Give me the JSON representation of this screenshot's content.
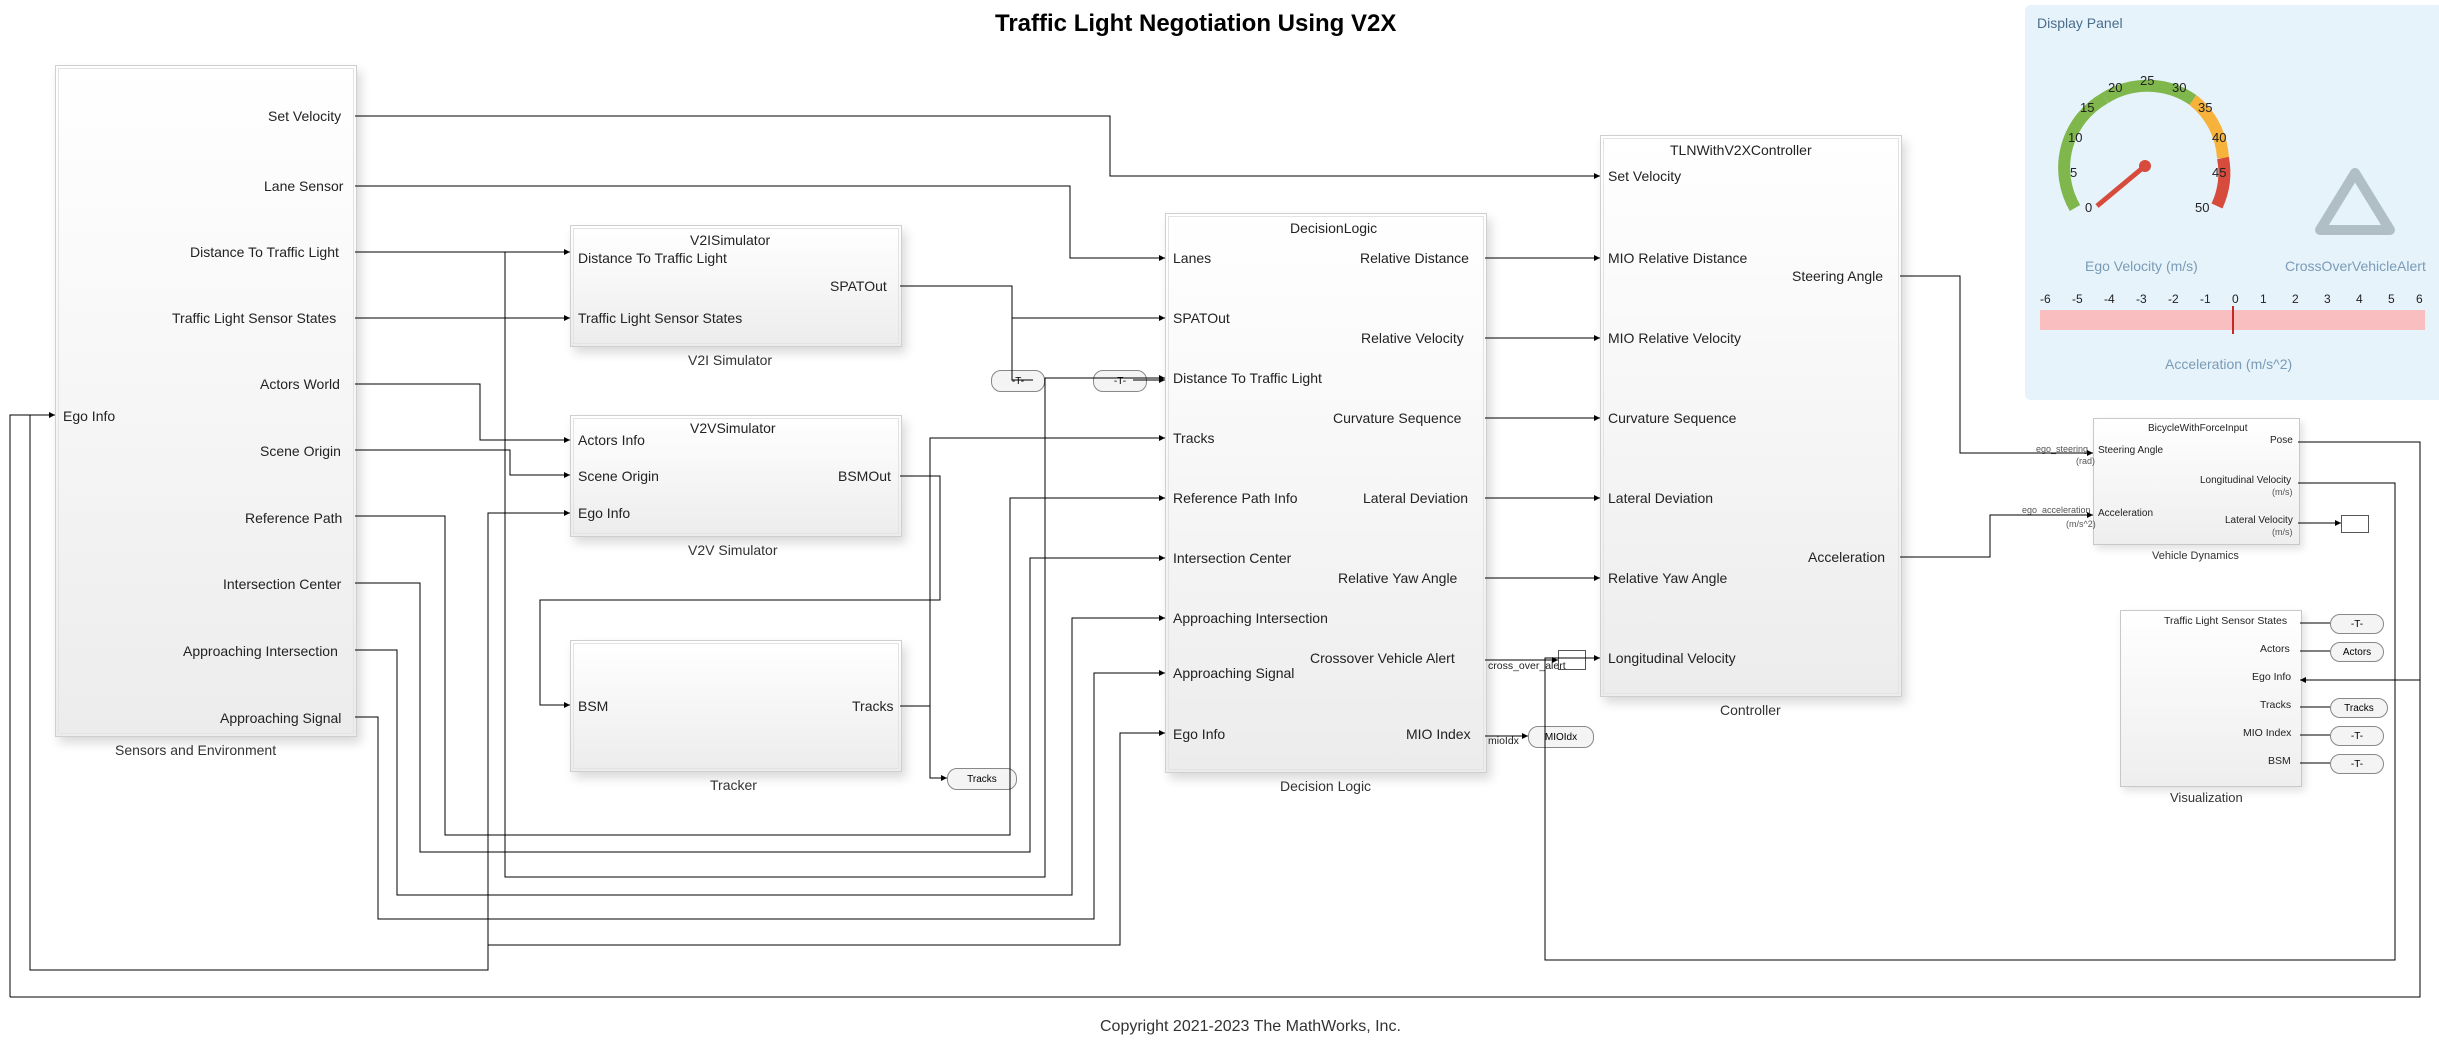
{
  "title": "Traffic Light Negotiation Using V2X",
  "copyright": "Copyright 2021-2023 The MathWorks, Inc.",
  "blocks": {
    "sensors": {
      "name": "Sensors and Environment",
      "inputs": [
        "Ego Info"
      ],
      "outputs": [
        "Set Velocity",
        "Lane Sensor",
        "Distance To Traffic Light",
        "Traffic Light Sensor States",
        "Actors World",
        "Scene Origin",
        "Reference Path",
        "Intersection Center",
        "Approaching Intersection",
        "Approaching Signal"
      ]
    },
    "v2i": {
      "name": "V2I Simulator",
      "header": "V2ISimulator",
      "inputs": [
        "Distance To Traffic Light",
        "Traffic Light Sensor States"
      ],
      "outputs": [
        "SPATOut"
      ]
    },
    "v2v": {
      "name": "V2V Simulator",
      "header": "V2VSimulator",
      "inputs": [
        "Actors Info",
        "Scene Origin",
        "Ego Info"
      ],
      "outputs": [
        "BSMOut"
      ]
    },
    "tracker": {
      "name": "Tracker",
      "inputs": [
        "BSM"
      ],
      "outputs": [
        "Tracks"
      ]
    },
    "decision": {
      "name": "Decision Logic",
      "header": "DecisionLogic",
      "inputs": [
        "Lanes",
        "SPATOut",
        "Distance To Traffic Light",
        "Tracks",
        "Reference Path Info",
        "Intersection Center",
        "Approaching Intersection",
        "Approaching Signal",
        "Ego Info"
      ],
      "outputs": [
        "Relative Distance",
        "Relative Velocity",
        "Curvature Sequence",
        "Lateral Deviation",
        "Relative Yaw Angle",
        "Crossover Vehicle Alert",
        "MIO Index"
      ]
    },
    "controller": {
      "name": "Controller",
      "header": "TLNWithV2XController",
      "inputs": [
        "Set Velocity",
        "MIO Relative Distance",
        "MIO Relative Velocity",
        "Curvature Sequence",
        "Lateral Deviation",
        "Relative Yaw Angle",
        "Longitudinal Velocity"
      ],
      "outputs": [
        "Steering Angle",
        "Acceleration"
      ]
    },
    "vdyn": {
      "name": "Vehicle Dynamics",
      "header": "BicycleWithForceInput",
      "inputs": [
        "Steering Angle",
        "Acceleration"
      ],
      "in_sig": [
        "ego_steering",
        "ego_acceleration"
      ],
      "in_units": [
        "(rad)",
        "(m/s^2)"
      ],
      "outputs": [
        "Pose",
        "Longitudinal Velocity",
        "Lateral Velocity"
      ],
      "out_units": [
        "",
        "(m/s)",
        "(m/s)"
      ]
    },
    "viz": {
      "name": "Visualization",
      "inputs": [
        "Traffic Light Sensor States",
        "Actors",
        "Ego Info",
        "Tracks",
        "MIO Index",
        "BSM"
      ]
    }
  },
  "gotos": {
    "from_t1": "-T-",
    "from_t2": "-T-",
    "tracks": "Tracks",
    "cross_over_alert": "cross_over_alert",
    "MIOIdx": "MIOIdx",
    "mioIdx": "mioIdx",
    "viz": [
      "-T-",
      "Actors",
      "",
      "Tracks",
      "-T-",
      "-T-"
    ]
  },
  "display_panel": {
    "title": "Display Panel",
    "gauge": {
      "label": "Ego Velocity (m/s)",
      "ticks": [
        0,
        5,
        10,
        15,
        20,
        25,
        30,
        35,
        40,
        45,
        50
      ],
      "value": 0
    },
    "alert_label": "CrossOverVehicleAlert",
    "accel": {
      "label": "Acceleration (m/s^2)",
      "min": -6,
      "max": 6,
      "ticks": [
        -6,
        -5,
        -4,
        -3,
        -2,
        -1,
        0,
        1,
        2,
        3,
        4,
        5,
        6
      ],
      "value": 0
    }
  }
}
